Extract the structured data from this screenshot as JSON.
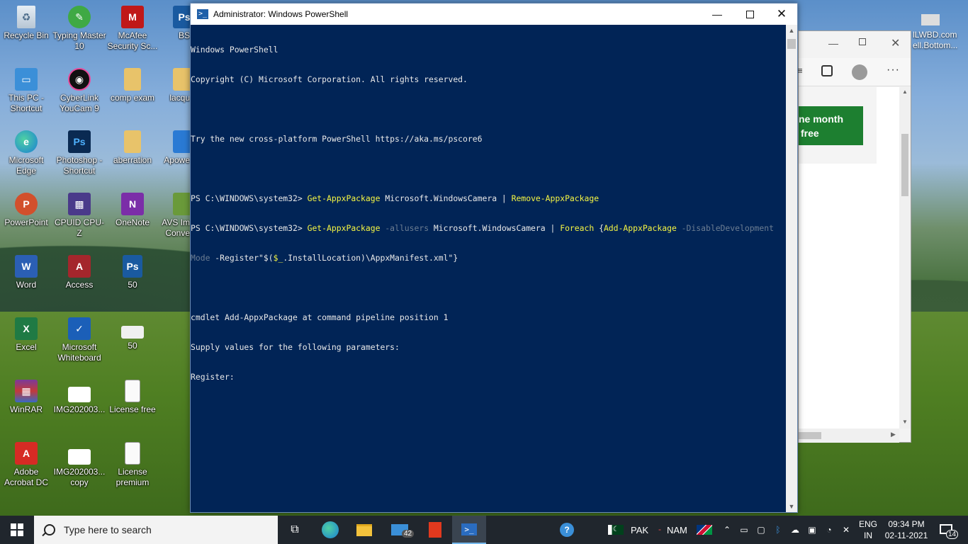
{
  "desktop": {
    "icons": [
      {
        "label": "Recycle Bin",
        "icon": "recycle-bin-icon"
      },
      {
        "label": "Typing Master 10",
        "icon": "typing-master-icon"
      },
      {
        "label": "McAfee Security Sc...",
        "icon": "mcafee-icon"
      },
      {
        "label": "BS",
        "icon": "psd-file-icon"
      },
      {
        "label": "This PC - Shortcut",
        "icon": "this-pc-icon"
      },
      {
        "label": "CyberLink YouCam 9",
        "icon": "youcam-icon"
      },
      {
        "label": "comp exam",
        "icon": "folder-icon"
      },
      {
        "label": "lacqu",
        "icon": "file-icon"
      },
      {
        "label": "Microsoft Edge",
        "icon": "edge-icon"
      },
      {
        "label": "Photoshop - Shortcut",
        "icon": "photoshop-icon"
      },
      {
        "label": "aberration",
        "icon": "folder-icon"
      },
      {
        "label": "Apowe",
        "icon": "apowersoft-icon"
      },
      {
        "label": "PowerPoint",
        "icon": "powerpoint-icon"
      },
      {
        "label": "CPUID CPU-Z",
        "icon": "cpuz-icon"
      },
      {
        "label": "OneNote",
        "icon": "onenote-icon"
      },
      {
        "label": "AVS Im Conve",
        "icon": "avs-icon"
      },
      {
        "label": "Word",
        "icon": "word-icon"
      },
      {
        "label": "Access",
        "icon": "access-icon"
      },
      {
        "label": "50",
        "icon": "psd-file-icon"
      },
      {
        "label": "Excel",
        "icon": "excel-icon"
      },
      {
        "label": "Microsoft Whiteboard",
        "icon": "whiteboard-icon"
      },
      {
        "label": "50",
        "icon": "image-file-icon"
      },
      {
        "label": "WinRAR",
        "icon": "winrar-icon"
      },
      {
        "label": "IMG202003...",
        "icon": "image-file-icon"
      },
      {
        "label": "License free",
        "icon": "text-file-icon"
      },
      {
        "label": "Adobe Acrobat DC",
        "icon": "acrobat-icon"
      },
      {
        "label": "IMG202003... copy",
        "icon": "image-file-icon"
      },
      {
        "label": "License premium",
        "icon": "text-file-icon"
      }
    ],
    "right_partial": {
      "line1": "lLWBD.com",
      "line2": "ell.Bottom..."
    }
  },
  "powershell": {
    "title": "Administrator: Windows PowerShell",
    "lines": {
      "l1": "Windows PowerShell",
      "l2": "Copyright (C) Microsoft Corporation. All rights reserved.",
      "l3": "",
      "l4": "Try the new cross-platform PowerShell https://aka.ms/pscore6",
      "l5": "",
      "l6_prompt": "PS C:\\WINDOWS\\system32> ",
      "l6_cmd1": "Get-AppxPackage",
      "l6_arg": " Microsoft.WindowsCamera | ",
      "l6_cmd2": "Remove-AppxPackage",
      "l7_prompt": "PS C:\\WINDOWS\\system32> ",
      "l7_cmd1": "Get-AppxPackage",
      "l7_param1": " -allusers",
      "l7_arg": " Microsoft.WindowsCamera | ",
      "l7_cmd2": "Foreach",
      "l7_brace": " {",
      "l7_cmd3": "Add-AppxPackage",
      "l7_param2": " -DisableDevelopment",
      "l8_param": "Mode",
      "l8_rest1": " -Register\"$(",
      "l8_var": "$_",
      "l8_rest2": ".InstallLocation)\\AppxManifest.xml\"}",
      "l9": "",
      "l10": "cmdlet Add-AppxPackage at command pipeline position 1",
      "l11": "Supply values for the following parameters:",
      "l12": "Register:"
    }
  },
  "background_window": {
    "cta_line1": "ne month",
    "cta_line2": "free"
  },
  "taskbar": {
    "search_placeholder": "Type here to search",
    "mail_badge": "42",
    "tray": {
      "pak": "PAK",
      "dash": "-",
      "nam": "NAM",
      "lang1": "ENG",
      "lang2": "IN",
      "time": "09:34 PM",
      "date": "02-11-2021",
      "notifications": "14"
    }
  },
  "colors": {
    "ps_background": "#012456",
    "ps_yellow": "#f5f543",
    "ps_gray": "#6c7d92",
    "taskbar": "#20262d",
    "accent": "#76b9ed"
  }
}
